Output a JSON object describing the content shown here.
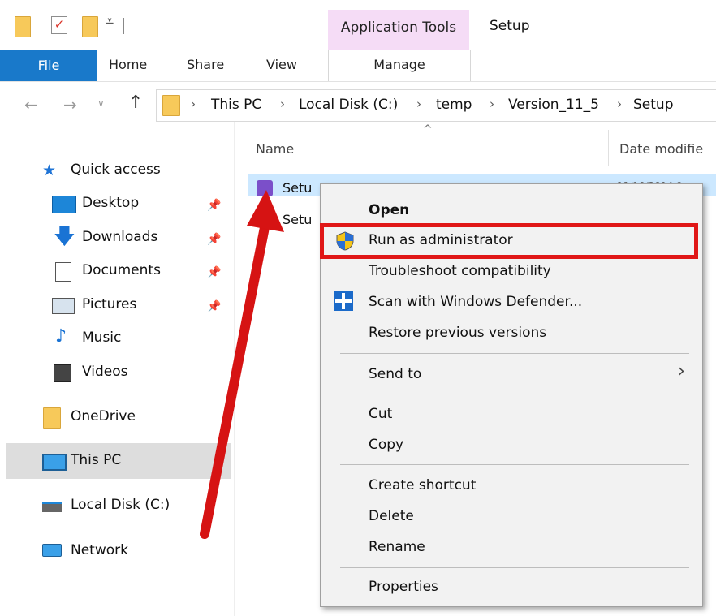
{
  "titlebar": {
    "context_tab": "Application Tools",
    "title": "Setup"
  },
  "ribbon": {
    "file_label": "File",
    "tabs": [
      "Home",
      "Share",
      "View"
    ],
    "manage_label": "Manage"
  },
  "address": {
    "crumbs": [
      "This PC",
      "Local Disk (C:)",
      "temp",
      "Version_11_5",
      "Setup"
    ]
  },
  "sidebar": {
    "quick_access": "Quick access",
    "items": [
      "Desktop",
      "Downloads",
      "Documents",
      "Pictures",
      "Music",
      "Videos"
    ],
    "onedrive": "OneDrive",
    "this_pc": "This PC",
    "local_disk": "Local Disk (C:)",
    "network": "Network"
  },
  "filelist": {
    "col_name": "Name",
    "col_date": "Date modifie",
    "files": [
      "Setu",
      "Setu"
    ],
    "date_partial": "11/10/2014 9"
  },
  "context_menu": {
    "open": "Open",
    "run_as_admin": "Run as administrator",
    "troubleshoot": "Troubleshoot compatibility",
    "scan": "Scan with Windows Defender...",
    "restore": "Restore previous versions",
    "send_to": "Send to",
    "cut": "Cut",
    "copy": "Copy",
    "create_shortcut": "Create shortcut",
    "delete": "Delete",
    "rename": "Rename",
    "properties": "Properties"
  },
  "colors": {
    "file_tab": "#1979ca",
    "context_tab_bg": "#f5dcf6",
    "highlight": "#e01717",
    "selection": "#cce8ff",
    "folder": "#f7c95a"
  }
}
